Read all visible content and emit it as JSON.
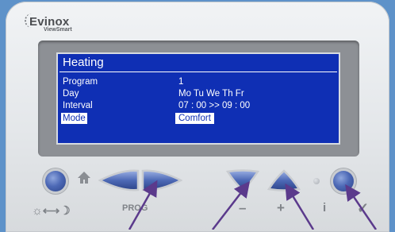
{
  "brand": {
    "name": "Evinox",
    "sub": "ViewSmart"
  },
  "screen": {
    "title": "Heating",
    "rows": [
      {
        "label": "Program",
        "value": "1"
      },
      {
        "label": "Day",
        "value": "Mo Tu We Th Fr"
      },
      {
        "label": "Interval",
        "value": "07 : 00  >>  09 : 00"
      },
      {
        "label": "Mode",
        "value": "Comfort"
      }
    ]
  },
  "labels": {
    "daynight": "☼⟷☽",
    "prog": "PROG",
    "minus": "–",
    "plus": "+",
    "info": "i",
    "ok": "✓"
  },
  "colors": {
    "lcd": "#0f2fb4",
    "button": "#4d69b6",
    "arrows": "#5b3a8c"
  }
}
